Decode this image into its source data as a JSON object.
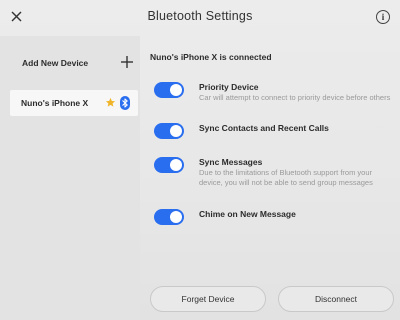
{
  "header": {
    "title": "Bluetooth Settings",
    "close_icon": "close-icon",
    "info_icon": "info-icon",
    "info_glyph": "i"
  },
  "sidebar": {
    "add_device_label": "Add New Device",
    "add_icon": "plus-icon",
    "devices": [
      {
        "name": "Nuno's iPhone X",
        "favorite_icon": "star-icon",
        "bluetooth_icon": "bluetooth-icon"
      }
    ]
  },
  "main": {
    "connected_status": "Nuno's iPhone X is connected",
    "settings": [
      {
        "label": "Priority Device",
        "description": "Car will attempt to connect to priority device before others",
        "enabled": true
      },
      {
        "label": "Sync Contacts and Recent Calls",
        "description": "",
        "enabled": true
      },
      {
        "label": "Sync Messages",
        "description": "Due to the limitations of Bluetooth support from your device, you will not be able to send group messages",
        "enabled": true
      },
      {
        "label": "Chime on New Message",
        "description": "",
        "enabled": true
      }
    ]
  },
  "footer": {
    "forget_label": "Forget Device",
    "disconnect_label": "Disconnect"
  },
  "colors": {
    "accent": "#2a6ef0",
    "star": "#f0b429",
    "background": "#e9e9e9"
  }
}
